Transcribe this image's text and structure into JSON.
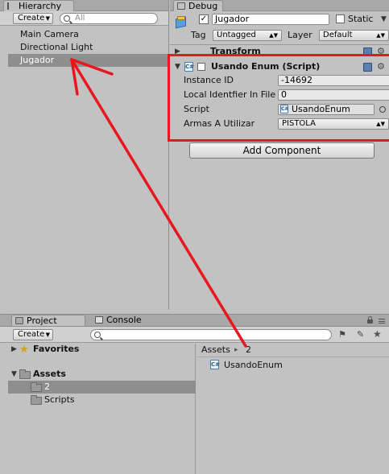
{
  "hierarchy": {
    "tab_label": "Hierarchy",
    "create_label": "Create",
    "search_placeholder": "All",
    "items": [
      {
        "label": "Main Camera"
      },
      {
        "label": "Directional Light"
      },
      {
        "label": "Jugador",
        "selected": true
      }
    ]
  },
  "inspector": {
    "tab_label": "Debug",
    "object_name": "Jugador",
    "static_label": "Static",
    "tag_label": "Tag",
    "tag_value": "Untagged",
    "layer_label": "Layer",
    "layer_value": "Default",
    "transform_label": "Transform",
    "component": {
      "title": "Usando Enum (Script)",
      "fields": [
        {
          "label": "Instance ID",
          "value": "-14692"
        },
        {
          "label": "Local Identfier In File",
          "value": "0"
        },
        {
          "label": "Script",
          "value": "UsandoEnum"
        },
        {
          "label": "Armas A Utilizar",
          "value": "PISTOLA"
        }
      ]
    },
    "add_component_label": "Add Component"
  },
  "project": {
    "tab_label": "Project",
    "console_tab_label": "Console",
    "create_label": "Create",
    "favorites_label": "Favorites",
    "assets_label": "Assets",
    "folders": [
      {
        "label": "2",
        "selected": true
      },
      {
        "label": "Scripts"
      }
    ],
    "breadcrumb_root": "Assets",
    "breadcrumb_sep": "▸",
    "breadcrumb_current": "2",
    "files": [
      {
        "label": "UsandoEnum"
      }
    ]
  },
  "colors": {
    "highlight_red": "#e8171f",
    "selection_gray": "#8e8e8e",
    "panel_bg": "#c2c2c2"
  }
}
